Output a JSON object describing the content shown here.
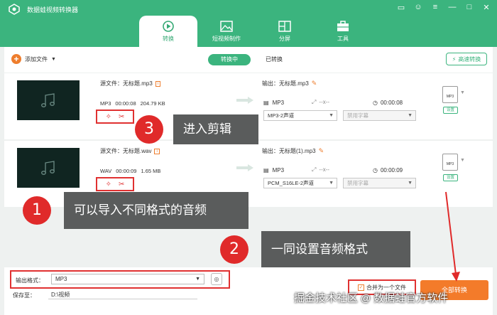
{
  "window": {
    "title": "数据蛙视频转换器",
    "controls": [
      "menu-icon",
      "feedback-icon",
      "more-icon",
      "minimize-icon",
      "maximize-icon",
      "close-icon"
    ]
  },
  "tabs": [
    {
      "label": "转换",
      "icon": "convert-icon",
      "active": true
    },
    {
      "label": "短视频制作",
      "icon": "image-icon",
      "active": false
    },
    {
      "label": "分屏",
      "icon": "split-screen-icon",
      "active": false
    },
    {
      "label": "工具",
      "icon": "toolbox-icon",
      "active": false
    }
  ],
  "toolbar": {
    "add_file": "添加文件",
    "mode_converting": "转换中",
    "mode_converted": "已转换",
    "fast_convert": "高速转换"
  },
  "files": [
    {
      "source": "源文件：无标题.mp3",
      "format": "MP3",
      "duration": "00:00:08",
      "size": "204.79 KB",
      "output": "输出：无标题.mp3",
      "out_format": "MP3",
      "out_resolution": "--x--",
      "out_duration": "00:00:08",
      "channel": "MP3-2声道",
      "subtitle": "禁用字幕",
      "fmt_badge": "MP3",
      "settings": "设置"
    },
    {
      "source": "源文件：无标题.wav",
      "format": "WAV",
      "duration": "00:00:09",
      "size": "1.65 MB",
      "output": "输出：无标题(1).mp3",
      "out_format": "MP3",
      "out_resolution": "--x--",
      "out_duration": "00:00:09",
      "channel": "PCM_S16LE-2声道",
      "subtitle": "禁用字幕",
      "fmt_badge": "MP3",
      "settings": "设置"
    }
  ],
  "callouts": [
    {
      "number": "3",
      "text": "进入剪辑"
    },
    {
      "number": "1",
      "text": "可以导入不同格式的音频"
    },
    {
      "number": "2",
      "text": "一同设置音频格式"
    }
  ],
  "bottom": {
    "output_format_label": "输出格式：",
    "output_format_value": "MP3",
    "save_label": "保存至：",
    "save_path": "D:\\视频",
    "merge_label": "合并为一个文件",
    "convert_all": "全部转换"
  },
  "watermark": {
    "left": "掘金技术社区",
    "at": "@",
    "right": "数据蛙官方软件"
  },
  "colors": {
    "brand_green": "#3bb47e",
    "accent_orange": "#f37b2a",
    "callout_red": "#e02a2a",
    "callout_gray": "#5a5c5c"
  }
}
